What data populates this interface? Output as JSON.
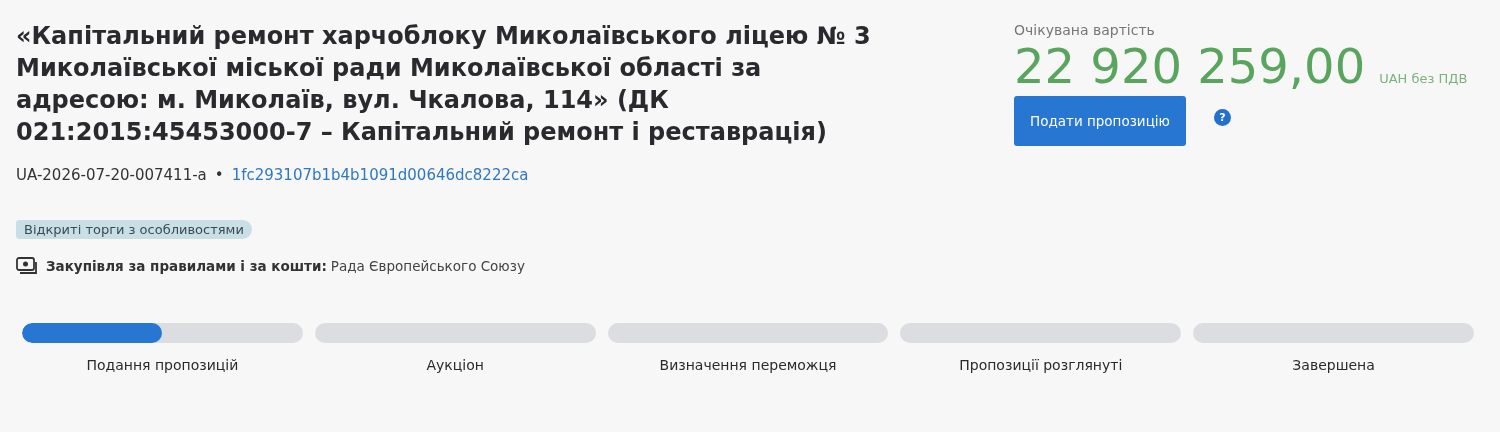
{
  "title": "«Капітальний ремонт харчоблоку Миколаївського ліцею № 3 Миколаївської міської ради Миколаївської області за адресою: м. Миколаїв, вул. Чкалова, 114» (ДК 021:2015:45453000-7 – Капітальний ремонт і реставрація)",
  "tender_id": "UA-2026-07-20-007411-a",
  "separator": "•",
  "hash_link": "1fc293107b1b4b1091d00646dc8222ca",
  "procedure_tag": "Відкриті торги з особливостями",
  "funding": {
    "label": "Закупівля за правилами і за кошти:",
    "value": "Рада Європейського Союзу"
  },
  "price": {
    "label": "Очікувана вартість",
    "amount": "22 920 259,00",
    "currency": "UAH без ПДВ"
  },
  "submit_button": "Подати пропозицію",
  "help": "?",
  "stages": [
    {
      "label": "Подання пропозицій",
      "level": 0.5
    },
    {
      "label": "Аукціон"
    },
    {
      "label": "Визначення переможця"
    },
    {
      "label": "Пропозиції розглянуті"
    },
    {
      "label": "Завершена"
    }
  ]
}
